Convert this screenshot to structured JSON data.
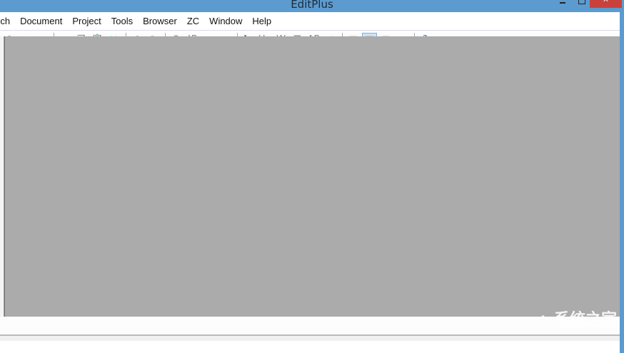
{
  "window": {
    "title": "EditPlus",
    "close_glyph": "^"
  },
  "menu": [
    "rch",
    "Document",
    "Project",
    "Tools",
    "Browser",
    "ZC",
    "Window",
    "Help"
  ],
  "toolbar": {
    "groups": [
      [
        {
          "icon": "print-icon",
          "g": "⎙"
        },
        {
          "icon": "spell-check-icon",
          "g": "✓"
        },
        {
          "icon": "html-preview-icon",
          "g": "◈"
        }
      ],
      [
        {
          "icon": "cut-icon",
          "g": "✂"
        },
        {
          "icon": "copy-icon",
          "g": "❐"
        },
        {
          "icon": "paste-icon",
          "g": "📋"
        },
        {
          "icon": "delete-icon",
          "g": "✕",
          "c": "#c0392b"
        }
      ],
      [
        {
          "icon": "undo-icon",
          "g": "↶"
        },
        {
          "icon": "redo-icon",
          "g": "↷"
        }
      ],
      [
        {
          "icon": "find-icon",
          "g": "⚲"
        },
        {
          "icon": "replace-icon",
          "g": "ᴬB"
        },
        {
          "icon": "goto-icon",
          "g": "⧉"
        },
        {
          "icon": "indent-icon",
          "g": "⇥"
        }
      ],
      [
        {
          "icon": "font-icon",
          "g": "Aa",
          "c": "#c0392b"
        },
        {
          "icon": "hex-icon",
          "g": "Hx"
        },
        {
          "icon": "word-wrap-icon",
          "g": "W"
        },
        {
          "icon": "line-number-icon",
          "g": "☰"
        },
        {
          "icon": "column-icon",
          "g": "AB"
        },
        {
          "icon": "check-icon",
          "g": "✔",
          "c": "#e8742c"
        }
      ],
      [
        {
          "icon": "directory-window-icon",
          "g": "▤"
        },
        {
          "icon": "output-window-icon",
          "g": "▥",
          "active": true
        },
        {
          "icon": "cliptext-icon",
          "g": "▦"
        },
        {
          "icon": "fullscreen-icon",
          "g": "⧉"
        }
      ],
      [
        {
          "icon": "help-icon",
          "g": "?",
          "c": "#3a6fb0"
        }
      ]
    ]
  },
  "watermark": "系统之家"
}
